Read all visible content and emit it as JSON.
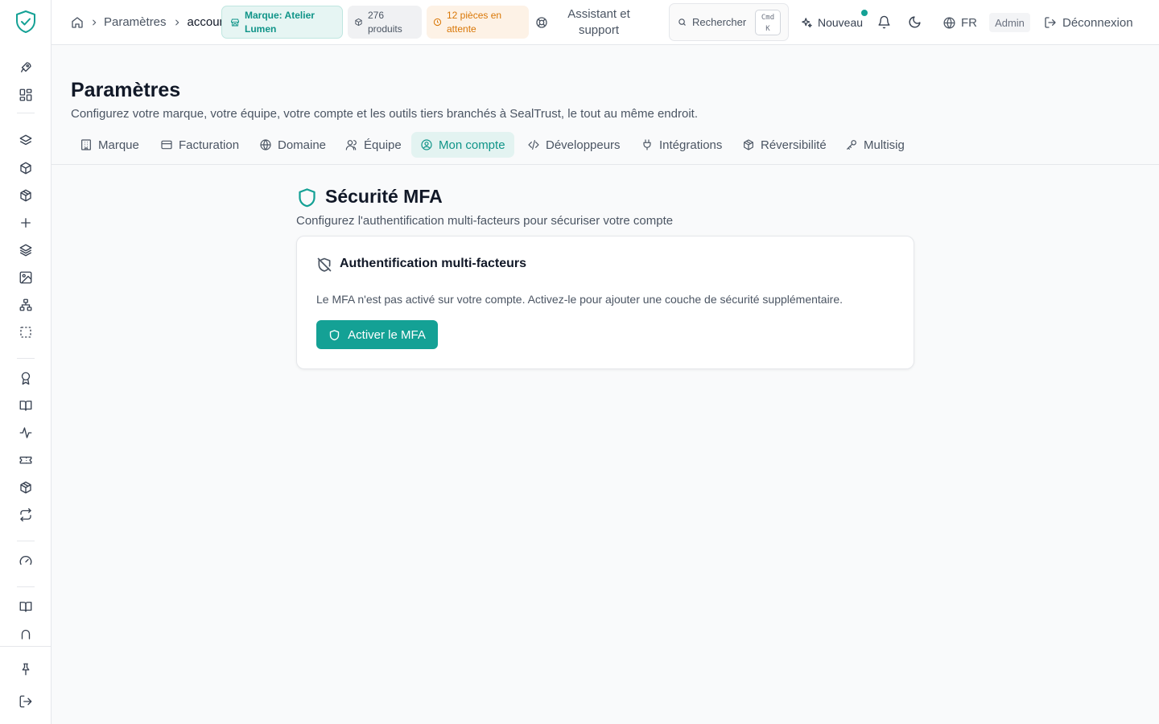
{
  "colors": {
    "accent": "#14a195",
    "accent_text": "#0f9488",
    "pending": "#d97706"
  },
  "sidebar": {
    "logo_icon": "shield-check-icon",
    "items": [
      {
        "icon": "rocket-icon"
      },
      {
        "icon": "dashboard-grid-icon"
      },
      {
        "icon": "layers-icon"
      },
      {
        "icon": "box-icon"
      },
      {
        "icon": "package-icon"
      },
      {
        "icon": "plus-icon"
      },
      {
        "icon": "layers-stack-icon"
      },
      {
        "icon": "image-icon"
      },
      {
        "icon": "sitemap-icon"
      },
      {
        "icon": "dashed-square-icon"
      },
      {
        "icon": "award-icon"
      },
      {
        "icon": "book-open-icon"
      },
      {
        "icon": "activity-icon"
      },
      {
        "icon": "ticket-icon"
      },
      {
        "icon": "package-check-icon"
      },
      {
        "icon": "repeat-icon"
      },
      {
        "icon": "gauge-icon"
      },
      {
        "icon": "book-icon"
      },
      {
        "icon": "arch-icon"
      },
      {
        "icon": "pin-icon"
      },
      {
        "icon": "logout-icon"
      }
    ]
  },
  "header": {
    "breadcrumb": {
      "home_icon": "home-icon",
      "items": [
        "Paramètres",
        "account"
      ]
    },
    "brand_chip": "Marque: Atelier Lumen",
    "products_chip": "276 produits",
    "pending_chip": "12 pièces en attente",
    "support_label": "Assistant et support",
    "search": {
      "placeholder": "Rechercher",
      "shortcut_line1": "Cmd",
      "shortcut_line2": "K"
    },
    "new_label": "Nouveau",
    "language": "FR",
    "role_badge": "Admin",
    "logout_label": "Déconnexion"
  },
  "page": {
    "title": "Paramètres",
    "description": "Configurez votre marque, votre équipe, votre compte et les outils tiers branchés à SealTrust, le tout au même endroit."
  },
  "tabs": [
    {
      "label": "Marque",
      "icon": "building-icon",
      "active": false
    },
    {
      "label": "Facturation",
      "icon": "credit-card-icon",
      "active": false
    },
    {
      "label": "Domaine",
      "icon": "globe-icon",
      "active": false
    },
    {
      "label": "Équipe",
      "icon": "users-icon",
      "active": false
    },
    {
      "label": "Mon compte",
      "icon": "user-circle-icon",
      "active": true
    },
    {
      "label": "Développeurs",
      "icon": "code-icon",
      "active": false
    },
    {
      "label": "Intégrations",
      "icon": "plug-icon",
      "active": false
    },
    {
      "label": "Réversibilité",
      "icon": "package-open-icon",
      "active": false
    },
    {
      "label": "Multisig",
      "icon": "key-icon",
      "active": false
    }
  ],
  "security": {
    "title": "Sécurité MFA",
    "subtitle": "Configurez l'authentification multi-facteurs pour sécuriser votre compte",
    "card": {
      "title": "Authentification multi-facteurs",
      "text": "Le MFA n'est pas activé sur votre compte. Activez-le pour ajouter une couche de sécurité supplémentaire.",
      "button_label": "Activer le MFA"
    }
  }
}
